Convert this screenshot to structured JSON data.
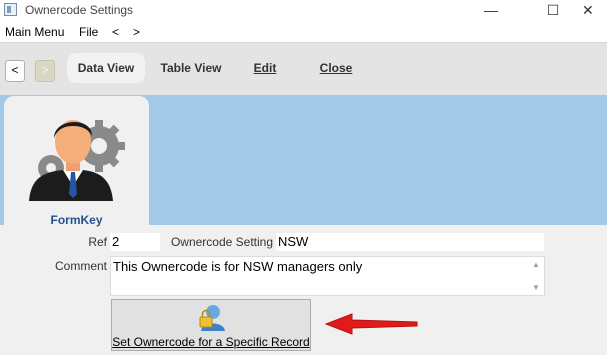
{
  "window": {
    "title": "Ownercode Settings",
    "minimize_glyph": "—",
    "maximize_glyph": "☐",
    "close_glyph": "✕"
  },
  "menu": {
    "items": [
      "Main Menu",
      "File",
      "<",
      ">"
    ]
  },
  "toolbar": {
    "back_label": "<",
    "forward_label": ">",
    "tabs": [
      "Data View",
      "Table View",
      "Edit",
      "Close"
    ],
    "active_tab": "Data View"
  },
  "formkey": {
    "label": "FormKey",
    "icon": "businessman-gears-icon"
  },
  "form": {
    "ref_label": "Ref",
    "ref_value": "2",
    "setting_label": "Ownercode Setting",
    "setting_value": "NSW",
    "comment_label": "Comment",
    "comment_value": "This Ownercode is for NSW managers only"
  },
  "action": {
    "label": "Set Ownercode for a Specific Record",
    "icon": "user-lock-icon"
  },
  "annotation": {
    "arrow_color": "#e01b1b"
  },
  "colors": {
    "band": "#a4c8e8",
    "formkey_text": "#23508f"
  }
}
